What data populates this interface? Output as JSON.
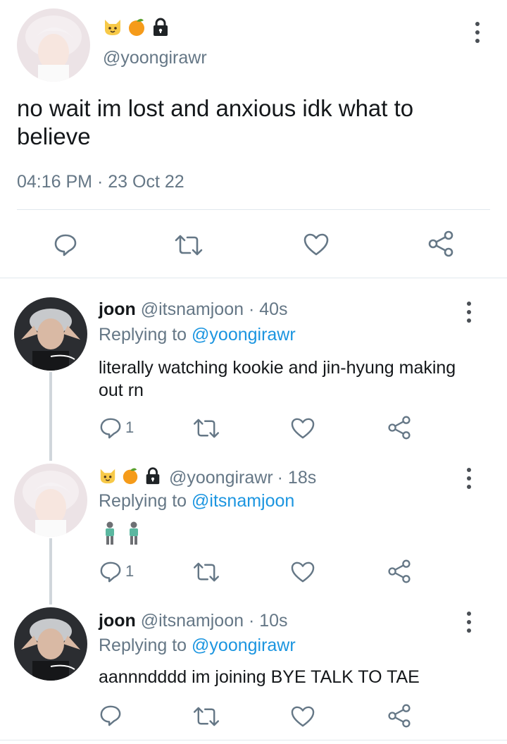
{
  "main_tweet": {
    "handle": "@yoongirawr",
    "name_emojis": [
      "cat-face-icon",
      "tangerine-icon",
      "lock-icon"
    ],
    "text": "no wait im lost and anxious idk what to believe",
    "time": "04:16 PM",
    "separator": "·",
    "date": "23 Oct 22"
  },
  "replies": [
    {
      "name": "joon",
      "handle": "@itsnamjoon",
      "age": "· 40s",
      "replying_label": "Replying to",
      "replying_to": "@yoongirawr",
      "text": "literally watching kookie and jin-hyung making out rn",
      "reply_count": "1"
    },
    {
      "name_emojis": [
        "cat-face-icon",
        "tangerine-icon",
        "lock-icon"
      ],
      "handle": "@yoongirawr",
      "age": "· 18s",
      "replying_label": "Replying to",
      "replying_to": "@itsnamjoon",
      "text_emojis": [
        "man-standing-icon",
        "man-standing-icon"
      ],
      "reply_count": "1"
    },
    {
      "name": "joon",
      "handle": "@itsnamjoon",
      "age": "· 10s",
      "replying_label": "Replying to",
      "replying_to": "@yoongirawr",
      "text": "aannndddd im joining BYE TALK TO TAE",
      "reply_count": ""
    }
  ],
  "colors": {
    "link": "#1b95e0",
    "muted": "#657786",
    "icon": "#657786"
  }
}
